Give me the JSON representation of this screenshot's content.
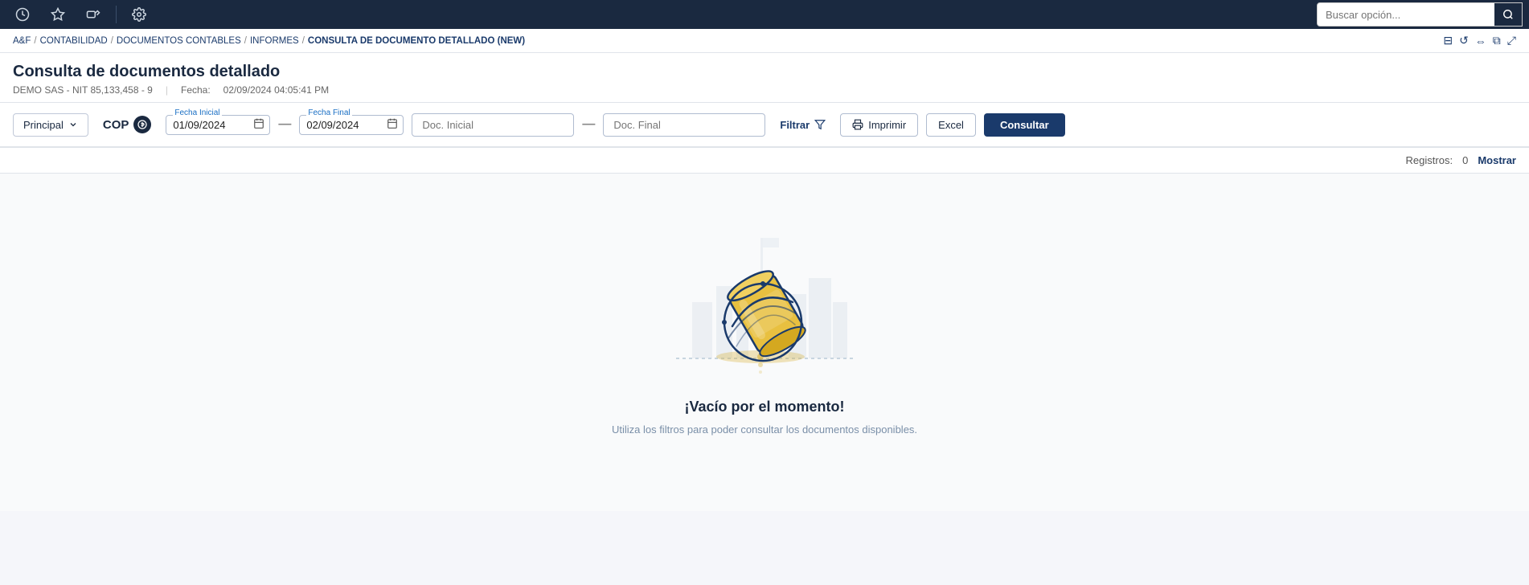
{
  "navbar": {
    "search_placeholder": "Buscar opción...",
    "icons": [
      "history-icon",
      "star-icon",
      "tag-icon",
      "settings-icon"
    ]
  },
  "breadcrumb": {
    "items": [
      {
        "label": "A&F",
        "link": true
      },
      {
        "label": "CONTABILIDAD",
        "link": true
      },
      {
        "label": "DOCUMENTOS CONTABLES",
        "link": true
      },
      {
        "label": "INFORMES",
        "link": true
      },
      {
        "label": "CONSULTA DE DOCUMENTO DETALLADO (NEW)",
        "link": false
      }
    ],
    "action_icons": [
      "help-icon",
      "refresh-icon",
      "split-icon",
      "copy-icon",
      "expand-icon"
    ]
  },
  "page": {
    "title": "Consulta de documentos detallado",
    "company": "DEMO SAS - NIT 85,133,458 - 9",
    "date_label": "Fecha:",
    "date_value": "02/09/2024 04:05:41 PM"
  },
  "toolbar": {
    "principal_label": "Principal",
    "currency_label": "COP",
    "fecha_inicial_label": "Fecha Inicial",
    "fecha_inicial_value": "01/09/2024",
    "fecha_final_label": "Fecha Final",
    "fecha_final_value": "02/09/2024",
    "doc_inicial_placeholder": "Doc. Inicial",
    "doc_final_placeholder": "Doc. Final",
    "filtrar_label": "Filtrar",
    "imprimir_label": "Imprimir",
    "excel_label": "Excel",
    "consultar_label": "Consultar"
  },
  "results": {
    "registros_label": "Registros:",
    "registros_count": "0",
    "mostrar_label": "Mostrar"
  },
  "empty_state": {
    "title": "¡Vacío por el momento!",
    "subtitle": "Utiliza los filtros para poder consultar los documentos disponibles."
  }
}
